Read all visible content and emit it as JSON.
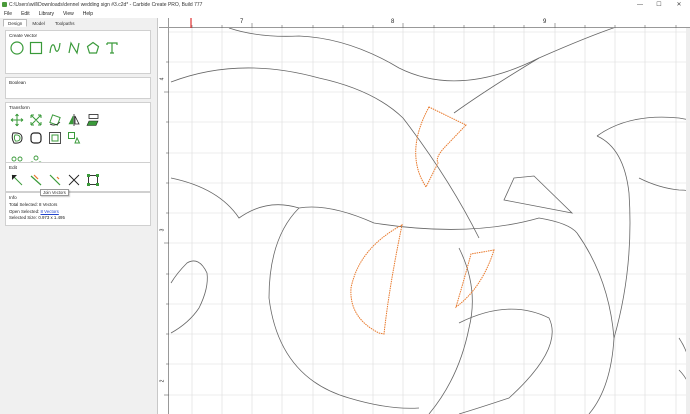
{
  "window": {
    "title": "C:\\Users\\will\\Downloads\\dennel wedding sign #3.c2d* - Carbide Create PRO, Build 777",
    "minimize": "—",
    "maximize": "☐",
    "close": "✕"
  },
  "menu": [
    "File",
    "Edit",
    "Library",
    "View",
    "Help"
  ],
  "tabs": [
    "Design",
    "Model",
    "Toolpaths"
  ],
  "sections": {
    "create_vector": "Create Vector",
    "boolean": "Boolean",
    "transform": "Transform",
    "edit": "Edit",
    "info": "Info"
  },
  "tooltip": "Join Vectors",
  "info": {
    "total_selected_label": "Total Selected:",
    "total_selected_value": "8 Vectors",
    "open_selected_label": "Open Selected:",
    "open_selected_value": "8 Vectors",
    "selected_size_label": "Selected Size:",
    "selected_size_value": "0.973 x 1.495"
  },
  "ruler": {
    "top_labels": [
      "7",
      "8",
      "9"
    ],
    "left_labels": [
      "4",
      "3",
      "2"
    ]
  },
  "colors": {
    "accent_green": "#3a9a3a",
    "selection_orange": "#e8782a",
    "vector_gray": "#666666",
    "grid": "#dcdcdc"
  },
  "icons": {
    "create_vector": [
      "circle-icon",
      "rectangle-icon",
      "curve-icon",
      "polyline-icon",
      "polygon-icon",
      "text-icon"
    ],
    "transform": [
      "move-icon",
      "scale-icon",
      "rotate-icon",
      "mirror-icon",
      "align-icon",
      "offset-icon",
      "fillet-icon",
      "group-icon",
      "ungroup-icon",
      "trim-icon",
      "circular-pattern-icon",
      "grid-pattern-icon"
    ],
    "edit": [
      "node-edit-icon",
      "join-vectors-icon",
      "split-icon",
      "cut-icon",
      "bounding-box-icon"
    ]
  }
}
